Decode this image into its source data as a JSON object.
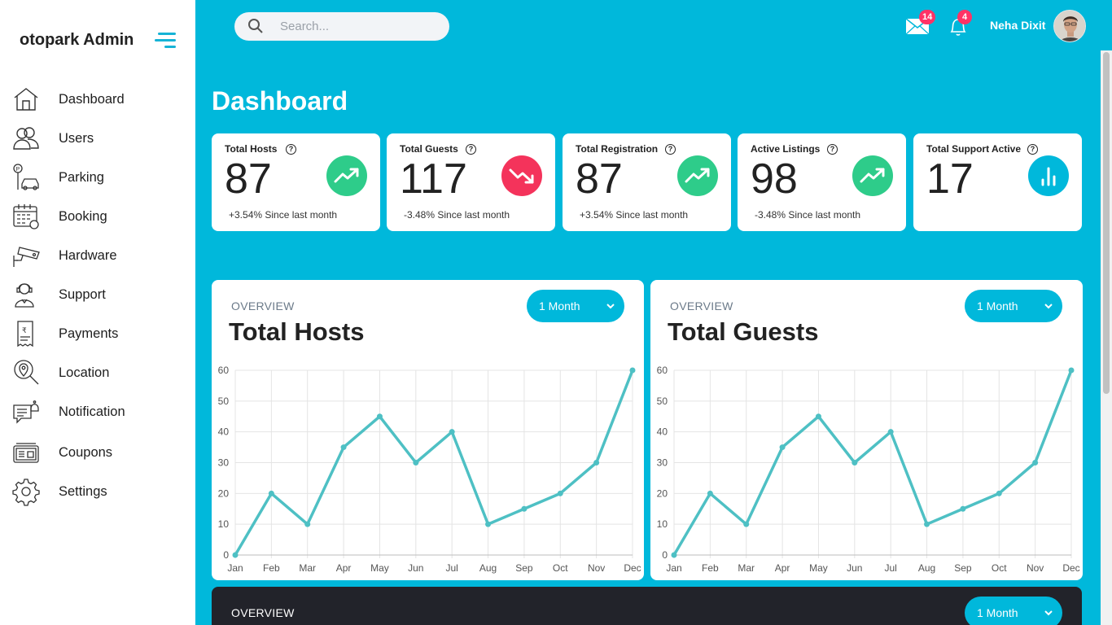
{
  "sidebar": {
    "brand": "otopark Admin",
    "items": [
      {
        "label": "Dashboard",
        "icon": "home-icon"
      },
      {
        "label": "Users",
        "icon": "users-icon"
      },
      {
        "label": "Parking",
        "icon": "parking-icon"
      },
      {
        "label": "Booking",
        "icon": "calendar-icon"
      },
      {
        "label": "Hardware",
        "icon": "cctv-camera-icon"
      },
      {
        "label": "Support",
        "icon": "support-agent-icon"
      },
      {
        "label": "Payments",
        "icon": "receipt-icon"
      },
      {
        "label": "Location",
        "icon": "location-search-icon"
      },
      {
        "label": "Notification",
        "icon": "chat-bell-icon"
      },
      {
        "label": "Coupons",
        "icon": "coupon-icon"
      },
      {
        "label": "Settings",
        "icon": "gear-icon"
      }
    ]
  },
  "header": {
    "search_placeholder": "Search...",
    "messages_count": "14",
    "notifications_count": "4",
    "user_name": "Neha Dixit"
  },
  "page_title": "Dashboard",
  "stats": [
    {
      "title": "Total Hosts",
      "value": "87",
      "change": "+3.54% Since last month",
      "icon": "trend-up-icon",
      "color": "#2ecc8a"
    },
    {
      "title": "Total Guests",
      "value": "117",
      "change": "-3.48% Since last month",
      "icon": "trend-down-icon",
      "color": "#f4335b"
    },
    {
      "title": "Total Registration",
      "value": "87",
      "change": "+3.54% Since last month",
      "icon": "trend-up-icon",
      "color": "#2ecc8a"
    },
    {
      "title": "Active Listings",
      "value": "98",
      "change": "-3.48% Since last month",
      "icon": "trend-up-icon",
      "color": "#2ecc8a"
    },
    {
      "title": "Total Support Active",
      "value": "17",
      "change": "",
      "icon": "bar-chart-icon",
      "color": "#00b8db"
    }
  ],
  "panels": [
    {
      "overline": "OVERVIEW",
      "title": "Total Hosts",
      "range": "1 Month"
    },
    {
      "overline": "OVERVIEW",
      "title": "Total Guests",
      "range": "1 Month"
    },
    {
      "overline": "OVERVIEW",
      "range": "1 Month"
    }
  ],
  "chart_data": [
    {
      "type": "line",
      "title": "Total Hosts",
      "categories": [
        "Jan",
        "Feb",
        "Mar",
        "Apr",
        "May",
        "Jun",
        "Jul",
        "Aug",
        "Sep",
        "Oct",
        "Nov",
        "Dec"
      ],
      "values": [
        0,
        20,
        10,
        35,
        45,
        30,
        40,
        10,
        15,
        20,
        30,
        60
      ],
      "ylim": [
        0,
        60
      ],
      "yticks": [
        0,
        10,
        20,
        30,
        40,
        50,
        60
      ],
      "grid": true,
      "color": "#4ec0c4"
    },
    {
      "type": "line",
      "title": "Total Guests",
      "categories": [
        "Jan",
        "Feb",
        "Mar",
        "Apr",
        "May",
        "Jun",
        "Jul",
        "Aug",
        "Sep",
        "Oct",
        "Nov",
        "Dec"
      ],
      "values": [
        0,
        20,
        10,
        35,
        45,
        30,
        40,
        10,
        15,
        20,
        30,
        60
      ],
      "ylim": [
        0,
        60
      ],
      "yticks": [
        0,
        10,
        20,
        30,
        40,
        50,
        60
      ],
      "grid": true,
      "color": "#4ec0c4"
    }
  ]
}
